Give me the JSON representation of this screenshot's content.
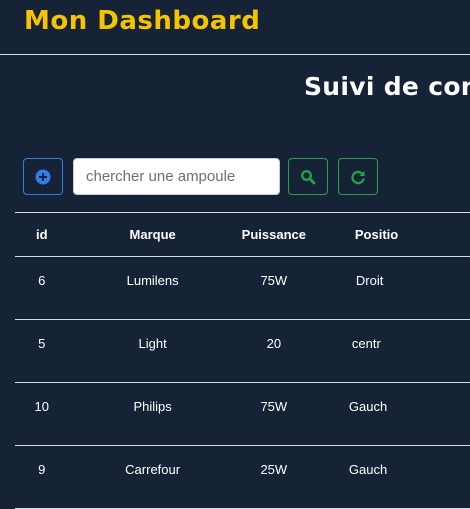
{
  "header": {
    "brand": "Mon Dashboard"
  },
  "main": {
    "title": "Suivi de con",
    "search": {
      "placeholder": "chercher une ampoule",
      "value": ""
    }
  },
  "icons": {
    "add": "plus-circle-icon",
    "search": "magnifier-icon",
    "refresh": "refresh-icon"
  },
  "colors": {
    "background": "#162336",
    "brand": "#f5c400",
    "primary": "#2f7ee8",
    "success": "#25a244"
  },
  "table": {
    "columns": [
      "id",
      "Marque",
      "Puissance",
      "Positio"
    ],
    "rows": [
      [
        "6",
        "Lumilens",
        "75W",
        "Droit"
      ],
      [
        "5",
        "Light",
        "20",
        "centr"
      ],
      [
        "10",
        "Philips",
        "75W",
        "Gauch"
      ],
      [
        "9",
        "Carrefour",
        "25W",
        "Gauch"
      ]
    ]
  }
}
